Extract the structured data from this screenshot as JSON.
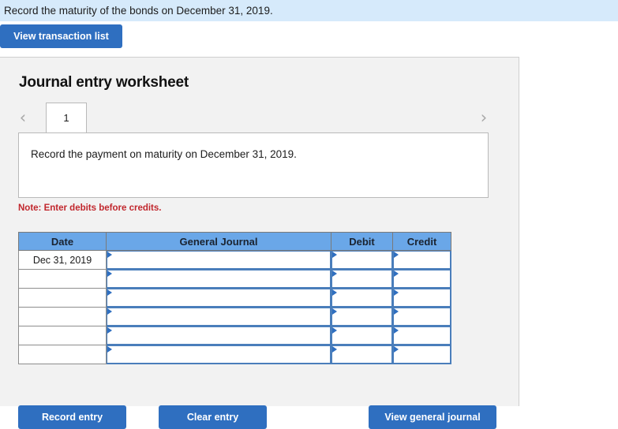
{
  "prompt": {
    "text": "Record the maturity of the bonds on December 31, 2019."
  },
  "toolbar": {
    "view_transaction_list_label": "View transaction list"
  },
  "worksheet": {
    "title": "Journal entry worksheet",
    "prev_arrow": "‹",
    "next_arrow": "›",
    "active_tab_label": "1",
    "instruction": "Record the payment on maturity on December 31, 2019.",
    "note": "Note: Enter debits before credits."
  },
  "journal_table": {
    "columns": [
      "Date",
      "General Journal",
      "Debit",
      "Credit"
    ],
    "rows": [
      {
        "date": "Dec 31, 2019",
        "general_journal": "",
        "debit": "",
        "credit": ""
      },
      {
        "date": "",
        "general_journal": "",
        "debit": "",
        "credit": ""
      },
      {
        "date": "",
        "general_journal": "",
        "debit": "",
        "credit": ""
      },
      {
        "date": "",
        "general_journal": "",
        "debit": "",
        "credit": ""
      },
      {
        "date": "",
        "general_journal": "",
        "debit": "",
        "credit": ""
      },
      {
        "date": "",
        "general_journal": "",
        "debit": "",
        "credit": ""
      }
    ]
  },
  "footer": {
    "record_entry_label": "Record entry",
    "clear_entry_label": "Clear entry",
    "view_general_journal_label": "View general journal"
  },
  "colors": {
    "banner_blue": "#d6eafb",
    "button_blue": "#2f6fc0",
    "header_blue": "#6aa7e8",
    "note_red": "#c1272d",
    "panel_gray": "#f2f2f2"
  }
}
